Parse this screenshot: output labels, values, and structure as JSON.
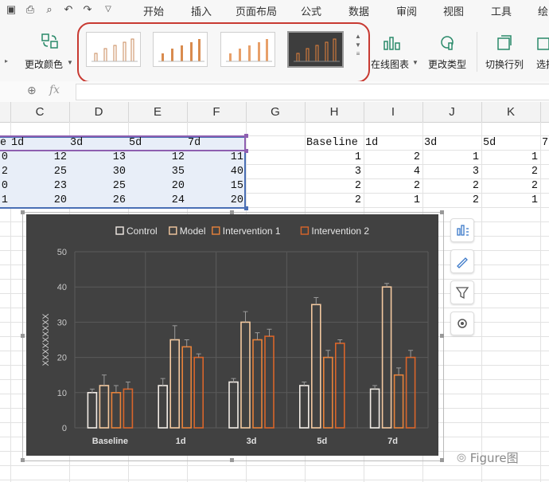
{
  "menu": {
    "tabs": [
      "开始",
      "插入",
      "页面布局",
      "公式",
      "数据",
      "审阅",
      "视图",
      "工具",
      "绘"
    ]
  },
  "ribbon": {
    "change_color": "更改颜色",
    "online_chart": "在线图表",
    "change_type": "更改类型",
    "switch_row_col": "切换行列",
    "select_data": "选择"
  },
  "formula_bar": {
    "fx": "fx",
    "zoom_icon": "magnifier-icon"
  },
  "columns": [
    "C",
    "D",
    "E",
    "F",
    "G",
    "H",
    "I",
    "J",
    "K"
  ],
  "table_left": {
    "header": [
      "e",
      "1d",
      "3d",
      "5d",
      "7d"
    ],
    "rows": [
      [
        "0",
        "12",
        "13",
        "12",
        "11"
      ],
      [
        "2",
        "25",
        "30",
        "35",
        "40"
      ],
      [
        "0",
        "23",
        "25",
        "20",
        "15"
      ],
      [
        "1",
        "20",
        "26",
        "24",
        "20"
      ]
    ]
  },
  "table_right": {
    "header": [
      "Baseline",
      "1d",
      "3d",
      "5d",
      "7"
    ],
    "rows": [
      [
        "1",
        "2",
        "1",
        "1"
      ],
      [
        "3",
        "4",
        "3",
        "2"
      ],
      [
        "2",
        "2",
        "2",
        "2"
      ],
      [
        "2",
        "1",
        "2",
        "1"
      ]
    ]
  },
  "chart_data": {
    "type": "bar",
    "title": "",
    "ylabel": "XXXXXXXXX",
    "xlabel": "",
    "categories": [
      "Baseline",
      "1d",
      "3d",
      "5d",
      "7d"
    ],
    "ylim": [
      0,
      50
    ],
    "yticks": [
      0,
      10,
      20,
      30,
      40,
      50
    ],
    "legend_position": "top",
    "grid": true,
    "series": [
      {
        "name": "Control",
        "values": [
          10,
          12,
          13,
          12,
          11
        ],
        "errors": [
          1,
          2,
          1,
          1,
          1
        ],
        "color": "#f2ece6"
      },
      {
        "name": "Model",
        "values": [
          12,
          25,
          30,
          35,
          40
        ],
        "errors": [
          3,
          4,
          3,
          2,
          1
        ],
        "color": "#f4c9a0"
      },
      {
        "name": "Intervention 1",
        "values": [
          10,
          23,
          25,
          20,
          15
        ],
        "errors": [
          2,
          2,
          2,
          2,
          2
        ],
        "color": "#e8823a"
      },
      {
        "name": "Intervention 2",
        "values": [
          11,
          20,
          26,
          24,
          20
        ],
        "errors": [
          2,
          1,
          2,
          1,
          2
        ],
        "color": "#d9652a"
      }
    ]
  },
  "watermark": "Figure图"
}
